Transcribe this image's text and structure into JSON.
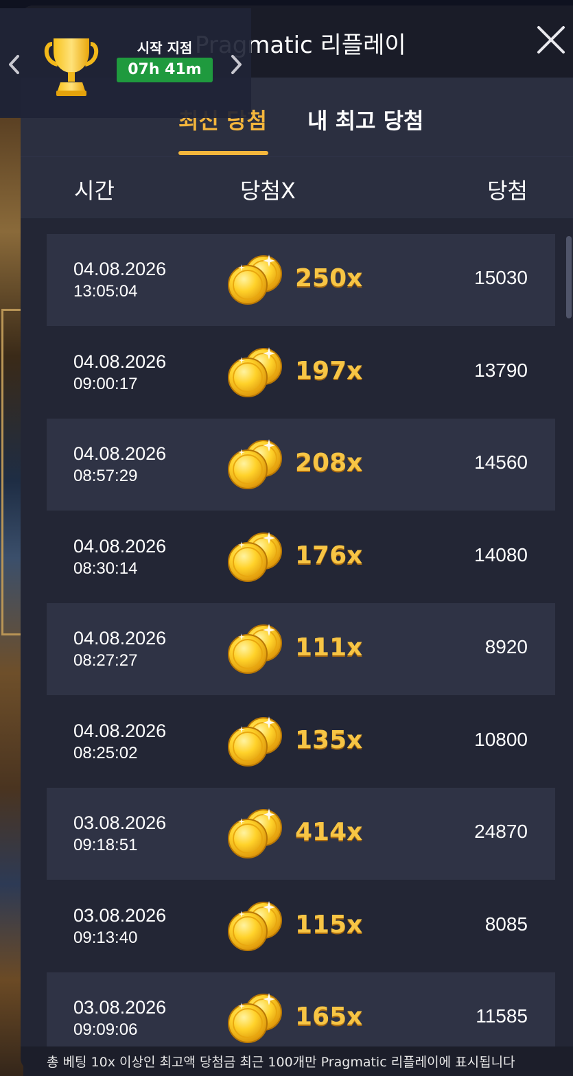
{
  "header": {
    "title": "Pragmatic 리플레이"
  },
  "tabs": [
    {
      "label": "최신 당첨",
      "active": true
    },
    {
      "label": "내 최고 당첨",
      "active": false
    }
  ],
  "columns": {
    "time": "시간",
    "multiplier": "당첨X",
    "win": "당첨"
  },
  "tournament": {
    "label": "시작 지점",
    "timer": "07h 41m"
  },
  "rows": [
    {
      "date": "04.08.2026",
      "time": "13:05:04",
      "multiplier": "250x",
      "win": "15030"
    },
    {
      "date": "04.08.2026",
      "time": "09:00:17",
      "multiplier": "197x",
      "win": "13790"
    },
    {
      "date": "04.08.2026",
      "time": "08:57:29",
      "multiplier": "208x",
      "win": "14560"
    },
    {
      "date": "04.08.2026",
      "time": "08:30:14",
      "multiplier": "176x",
      "win": "14080"
    },
    {
      "date": "04.08.2026",
      "time": "08:27:27",
      "multiplier": "111x",
      "win": "8920"
    },
    {
      "date": "04.08.2026",
      "time": "08:25:02",
      "multiplier": "135x",
      "win": "10800"
    },
    {
      "date": "03.08.2026",
      "time": "09:18:51",
      "multiplier": "414x",
      "win": "24870"
    },
    {
      "date": "03.08.2026",
      "time": "09:13:40",
      "multiplier": "115x",
      "win": "8085"
    },
    {
      "date": "03.08.2026",
      "time": "09:09:06",
      "multiplier": "165x",
      "win": "11585"
    }
  ],
  "footer": {
    "note": "총 베팅 10x 이상인 최고액 당첨금 최근 100개만 Pragmatic 리플레이에 표시됩니다"
  },
  "colors": {
    "accent": "#f4b63c",
    "panel": "#232635",
    "row_alt": "#2f3345",
    "timer_badge": "#1f9a3e"
  },
  "icons": [
    "trophy-icon",
    "chevron-left-icon",
    "chevron-right-icon",
    "close-icon",
    "gold-coins-icon"
  ]
}
